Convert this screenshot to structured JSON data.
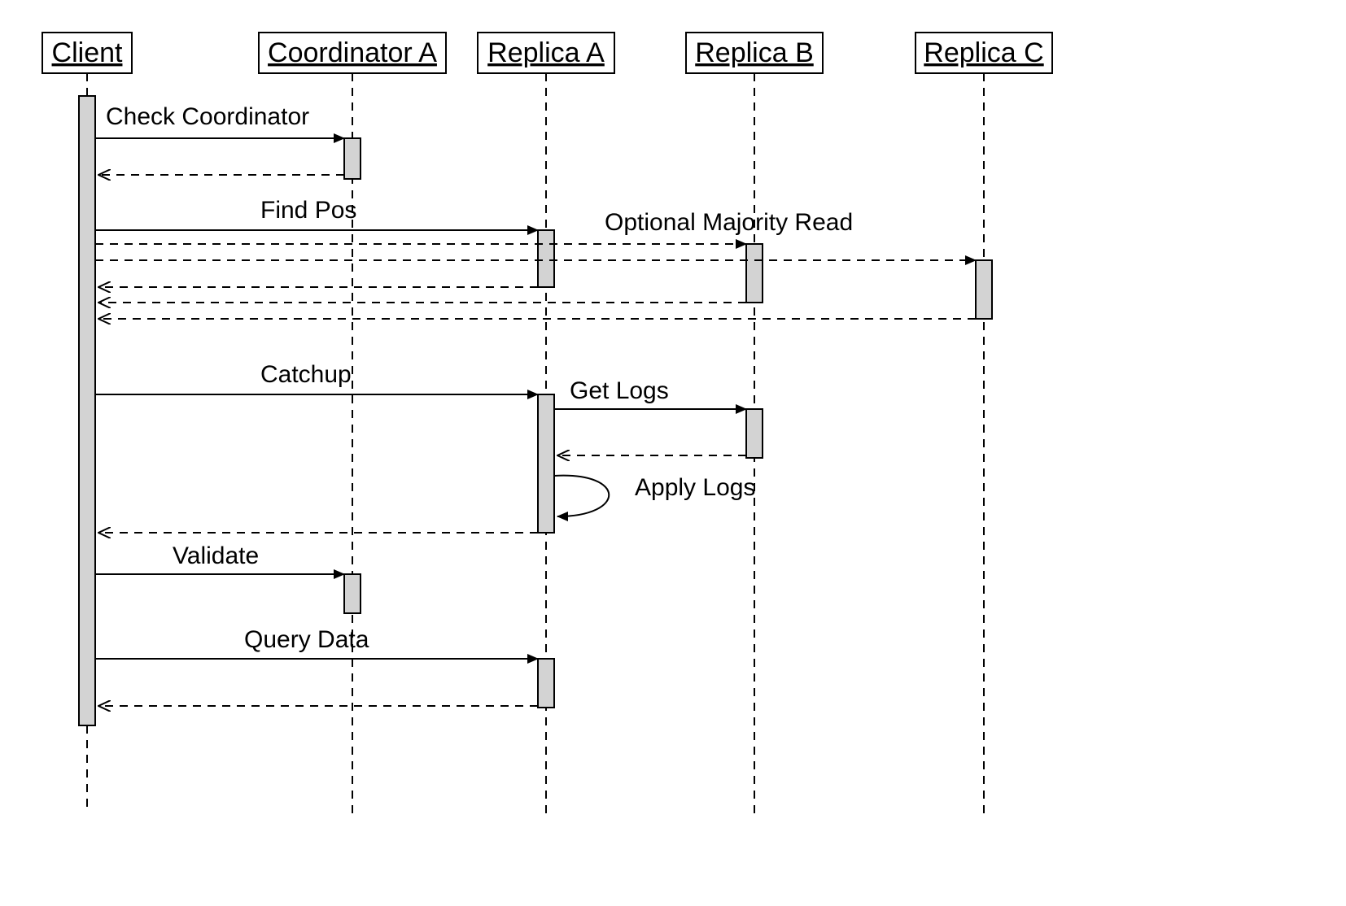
{
  "participants": {
    "client": {
      "label": "Client"
    },
    "coordinatorA": {
      "label": "Coordinator A"
    },
    "replicaA": {
      "label": "Replica A"
    },
    "replicaB": {
      "label": "Replica B"
    },
    "replicaC": {
      "label": "Replica C"
    }
  },
  "messages": {
    "checkCoordinator": "Check Coordinator",
    "findPos": "Find Pos",
    "optionalMajorityRead": "Optional Majority Read",
    "catchup": "Catchup",
    "getLogs": "Get Logs",
    "applyLogs": "Apply Logs",
    "validate": "Validate",
    "queryData": "Query Data"
  }
}
